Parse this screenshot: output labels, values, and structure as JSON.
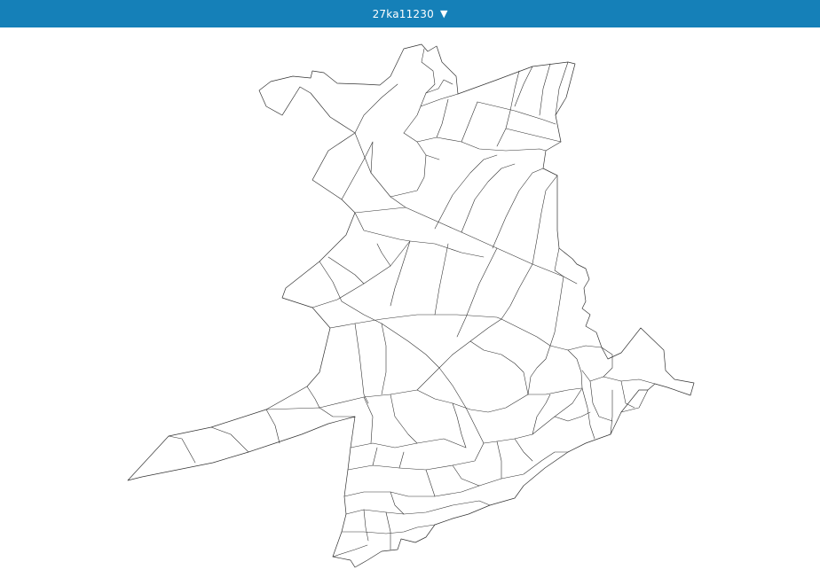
{
  "header": {
    "title": "27ka11230",
    "dropdown_icon": "triangle-down-icon",
    "background_color": "#1580b8",
    "text_color": "#ffffff"
  },
  "map": {
    "line_color": "#333333",
    "fill_color": "#ffffff"
  }
}
